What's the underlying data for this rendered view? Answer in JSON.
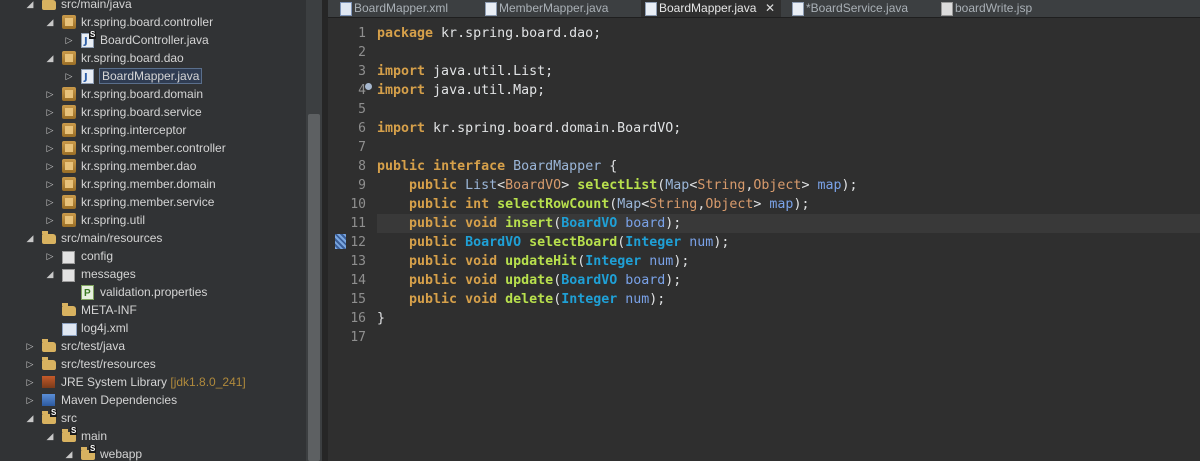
{
  "explorer": {
    "items": [
      {
        "label": "src/main/java",
        "depth": 1,
        "arrow": "expanded",
        "icon": "source-folder",
        "badge": "",
        "suffix": ""
      },
      {
        "label": "kr.spring.board.controller",
        "depth": 2,
        "arrow": "expanded",
        "icon": "package",
        "badge": "",
        "suffix": ""
      },
      {
        "label": "BoardController.java",
        "depth": 3,
        "arrow": "collapsed",
        "icon": "java-file",
        "badge": "S",
        "suffix": ""
      },
      {
        "label": "kr.spring.board.dao",
        "depth": 2,
        "arrow": "expanded",
        "icon": "package",
        "badge": "",
        "suffix": ""
      },
      {
        "label": "BoardMapper.java",
        "depth": 3,
        "arrow": "collapsed",
        "icon": "java-file",
        "badge": "",
        "suffix": "",
        "selected": true
      },
      {
        "label": "kr.spring.board.domain",
        "depth": 2,
        "arrow": "collapsed",
        "icon": "package",
        "badge": "",
        "suffix": ""
      },
      {
        "label": "kr.spring.board.service",
        "depth": 2,
        "arrow": "collapsed",
        "icon": "package",
        "badge": "",
        "suffix": ""
      },
      {
        "label": "kr.spring.interceptor",
        "depth": 2,
        "arrow": "collapsed",
        "icon": "package",
        "badge": "",
        "suffix": ""
      },
      {
        "label": "kr.spring.member.controller",
        "depth": 2,
        "arrow": "collapsed",
        "icon": "package",
        "badge": "",
        "suffix": ""
      },
      {
        "label": "kr.spring.member.dao",
        "depth": 2,
        "arrow": "collapsed",
        "icon": "package",
        "badge": "",
        "suffix": ""
      },
      {
        "label": "kr.spring.member.domain",
        "depth": 2,
        "arrow": "collapsed",
        "icon": "package",
        "badge": "",
        "suffix": ""
      },
      {
        "label": "kr.spring.member.service",
        "depth": 2,
        "arrow": "collapsed",
        "icon": "package",
        "badge": "",
        "suffix": ""
      },
      {
        "label": "kr.spring.util",
        "depth": 2,
        "arrow": "collapsed",
        "icon": "package",
        "badge": "",
        "suffix": ""
      },
      {
        "label": "src/main/resources",
        "depth": 1,
        "arrow": "expanded",
        "icon": "source-folder",
        "badge": "",
        "suffix": ""
      },
      {
        "label": "config",
        "depth": 2,
        "arrow": "collapsed",
        "icon": "grid-folder",
        "badge": "",
        "suffix": ""
      },
      {
        "label": "messages",
        "depth": 2,
        "arrow": "expanded",
        "icon": "grid-folder",
        "badge": "",
        "suffix": ""
      },
      {
        "label": "validation.properties",
        "depth": 3,
        "arrow": "none",
        "icon": "properties-file",
        "badge": "",
        "suffix": ""
      },
      {
        "label": "META-INF",
        "depth": 2,
        "arrow": "none",
        "icon": "folder",
        "badge": "",
        "suffix": ""
      },
      {
        "label": "log4j.xml",
        "depth": 2,
        "arrow": "none",
        "icon": "xml-file",
        "badge": "",
        "suffix": ""
      },
      {
        "label": "src/test/java",
        "depth": 1,
        "arrow": "collapsed",
        "icon": "source-folder",
        "badge": "",
        "suffix": ""
      },
      {
        "label": "src/test/resources",
        "depth": 1,
        "arrow": "collapsed",
        "icon": "source-folder",
        "badge": "",
        "suffix": ""
      },
      {
        "label": "JRE System Library",
        "depth": 1,
        "arrow": "collapsed",
        "icon": "library",
        "badge": "",
        "suffix": "[jdk1.8.0_241]"
      },
      {
        "label": "Maven Dependencies",
        "depth": 1,
        "arrow": "collapsed",
        "icon": "maven-library",
        "badge": "",
        "suffix": ""
      },
      {
        "label": "src",
        "depth": 1,
        "arrow": "expanded",
        "icon": "folder",
        "badge": "S",
        "suffix": ""
      },
      {
        "label": "main",
        "depth": 2,
        "arrow": "expanded",
        "icon": "folder",
        "badge": "S",
        "suffix": ""
      },
      {
        "label": "webapp",
        "depth": 3,
        "arrow": "expanded",
        "icon": "folder",
        "badge": "S",
        "suffix": ""
      }
    ]
  },
  "tabs": [
    {
      "label": "BoardMapper.xml",
      "icon": "xml-file",
      "active": false
    },
    {
      "label": "MemberMapper.java",
      "icon": "java-file",
      "active": false
    },
    {
      "label": "BoardMapper.java",
      "icon": "java-file",
      "active": true,
      "close": "✕"
    },
    {
      "label": "*BoardService.java",
      "icon": "java-file",
      "active": false
    },
    {
      "label": "boardWrite.jsp",
      "icon": "jsp-file",
      "active": false
    }
  ],
  "editor": {
    "current_line": 11,
    "lines": [
      {
        "n": "1",
        "tokens": [
          [
            "kw",
            "package"
          ],
          [
            "t",
            " kr.spring.board.dao;"
          ]
        ]
      },
      {
        "n": "2",
        "tokens": []
      },
      {
        "n": "3",
        "tokens": [
          [
            "kw",
            "import"
          ],
          [
            "t",
            " java.util.List;"
          ]
        ]
      },
      {
        "n": "4",
        "tokens": [
          [
            "kw",
            "import"
          ],
          [
            "t",
            " java.util.Map;"
          ]
        ]
      },
      {
        "n": "5",
        "tokens": []
      },
      {
        "n": "6",
        "tokens": [
          [
            "kw",
            "import"
          ],
          [
            "t",
            " kr.spring.board.domain.BoardVO;"
          ]
        ]
      },
      {
        "n": "7",
        "tokens": []
      },
      {
        "n": "8",
        "tokens": [
          [
            "kw",
            "public"
          ],
          [
            "t",
            " "
          ],
          [
            "kw",
            "interface"
          ],
          [
            "t",
            " "
          ],
          [
            "typ",
            "BoardMapper"
          ],
          [
            "t",
            " {"
          ]
        ]
      },
      {
        "n": "9",
        "tokens": [
          [
            "t",
            "    "
          ],
          [
            "kw",
            "public"
          ],
          [
            "t",
            " "
          ],
          [
            "typ",
            "List"
          ],
          [
            "t",
            "<"
          ],
          [
            "gen",
            "BoardVO"
          ],
          [
            "t",
            "> "
          ],
          [
            "mth",
            "selectList"
          ],
          [
            "t",
            "("
          ],
          [
            "typ",
            "Map"
          ],
          [
            "t",
            "<"
          ],
          [
            "gen",
            "String"
          ],
          [
            "t",
            ","
          ],
          [
            "gen",
            "Object"
          ],
          [
            "t",
            "> "
          ],
          [
            "par",
            "map"
          ],
          [
            "t",
            ");"
          ]
        ]
      },
      {
        "n": "10",
        "tokens": [
          [
            "t",
            "    "
          ],
          [
            "kw",
            "public"
          ],
          [
            "t",
            " "
          ],
          [
            "kw",
            "int"
          ],
          [
            "t",
            " "
          ],
          [
            "mth",
            "selectRowCount"
          ],
          [
            "t",
            "("
          ],
          [
            "typ",
            "Map"
          ],
          [
            "t",
            "<"
          ],
          [
            "gen",
            "String"
          ],
          [
            "t",
            ","
          ],
          [
            "gen",
            "Object"
          ],
          [
            "t",
            "> "
          ],
          [
            "par",
            "map"
          ],
          [
            "t",
            ");"
          ]
        ]
      },
      {
        "n": "11",
        "tokens": [
          [
            "t",
            "    "
          ],
          [
            "kw",
            "public"
          ],
          [
            "t",
            " "
          ],
          [
            "kw",
            "void"
          ],
          [
            "t",
            " "
          ],
          [
            "mth",
            "insert"
          ],
          [
            "t",
            "("
          ],
          [
            "ty",
            "BoardVO"
          ],
          [
            "t",
            " "
          ],
          [
            "par",
            "board"
          ],
          [
            "t",
            ");"
          ]
        ]
      },
      {
        "n": "12",
        "tokens": [
          [
            "t",
            "    "
          ],
          [
            "kw",
            "public"
          ],
          [
            "t",
            " "
          ],
          [
            "ty",
            "BoardVO"
          ],
          [
            "t",
            " "
          ],
          [
            "mth",
            "selectBoard"
          ],
          [
            "t",
            "("
          ],
          [
            "ty",
            "Integer"
          ],
          [
            "t",
            " "
          ],
          [
            "par",
            "num"
          ],
          [
            "t",
            ");"
          ]
        ]
      },
      {
        "n": "13",
        "tokens": [
          [
            "t",
            "    "
          ],
          [
            "kw",
            "public"
          ],
          [
            "t",
            " "
          ],
          [
            "kw",
            "void"
          ],
          [
            "t",
            " "
          ],
          [
            "mth",
            "updateHit"
          ],
          [
            "t",
            "("
          ],
          [
            "ty",
            "Integer"
          ],
          [
            "t",
            " "
          ],
          [
            "par",
            "num"
          ],
          [
            "t",
            ");"
          ]
        ]
      },
      {
        "n": "14",
        "tokens": [
          [
            "t",
            "    "
          ],
          [
            "kw",
            "public"
          ],
          [
            "t",
            " "
          ],
          [
            "kw",
            "void"
          ],
          [
            "t",
            " "
          ],
          [
            "mth",
            "update"
          ],
          [
            "t",
            "("
          ],
          [
            "ty",
            "BoardVO"
          ],
          [
            "t",
            " "
          ],
          [
            "par",
            "board"
          ],
          [
            "t",
            ");"
          ]
        ]
      },
      {
        "n": "15",
        "tokens": [
          [
            "t",
            "    "
          ],
          [
            "kw",
            "public"
          ],
          [
            "t",
            " "
          ],
          [
            "kw",
            "void"
          ],
          [
            "t",
            " "
          ],
          [
            "mth",
            "delete"
          ],
          [
            "t",
            "("
          ],
          [
            "ty",
            "Integer"
          ],
          [
            "t",
            " "
          ],
          [
            "par",
            "num"
          ],
          [
            "t",
            ");"
          ]
        ]
      },
      {
        "n": "16",
        "tokens": [
          [
            "t",
            "}"
          ]
        ]
      },
      {
        "n": "17",
        "tokens": []
      }
    ]
  },
  "colors": {
    "keyword": "#d6a04a",
    "type": "#1fa0d6",
    "method": "#b8e04d",
    "param": "#7aa2e8",
    "generic": "#d89b6c"
  }
}
